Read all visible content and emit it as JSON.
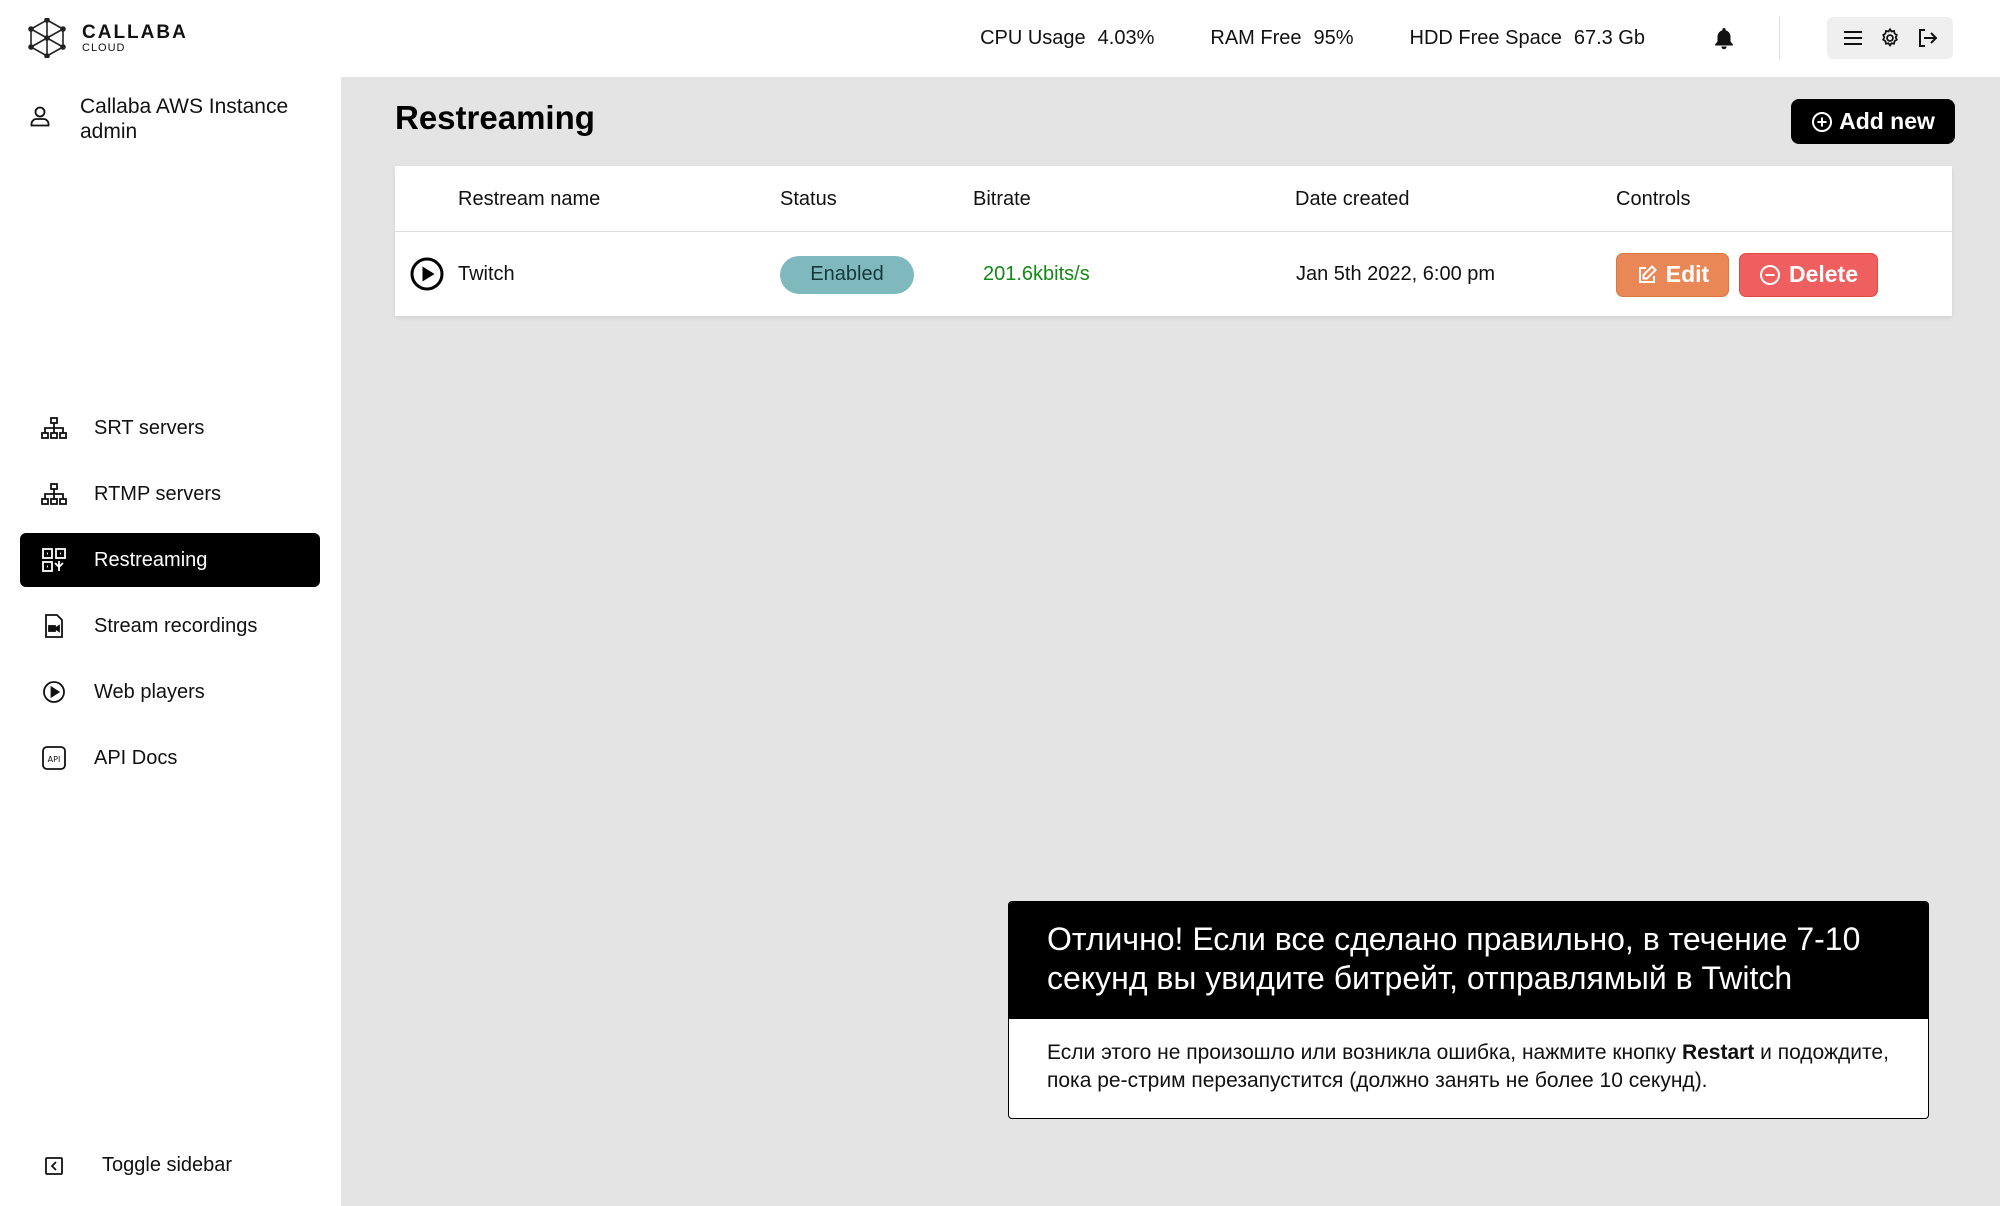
{
  "app": {
    "logo_name": "CALLABA",
    "logo_sub": "CLOUD",
    "instance": "Callaba AWS Instance",
    "user": "admin"
  },
  "nav": {
    "items": [
      {
        "label": "SRT servers",
        "icon": "sitemap-icon"
      },
      {
        "label": "RTMP servers",
        "icon": "sitemap-icon"
      },
      {
        "label": "Restreaming",
        "icon": "restream-icon",
        "active": true
      },
      {
        "label": "Stream recordings",
        "icon": "video-file-icon"
      },
      {
        "label": "Web players",
        "icon": "play-circle-icon"
      },
      {
        "label": "API Docs",
        "icon": "api-icon"
      }
    ],
    "toggle_label": "Toggle sidebar"
  },
  "topbar": {
    "cpu_label": "CPU Usage",
    "cpu_value": "4.03%",
    "ram_label": "RAM Free",
    "ram_value": "95%",
    "hdd_label": "HDD Free Space",
    "hdd_value": "67.3 Gb"
  },
  "main": {
    "title": "Restreaming",
    "add_new_label": "Add new",
    "columns": [
      "Restream name",
      "Status",
      "Bitrate",
      "Date created",
      "Controls"
    ],
    "rows": [
      {
        "name": "Twitch",
        "status": "Enabled",
        "bitrate": "201.6kbits/s",
        "date": "Jan 5th 2022, 6:00 pm",
        "edit_label": "Edit",
        "delete_label": "Delete"
      }
    ]
  },
  "tooltip": {
    "heading": "Отлично! Если все сделано правильно, в течение 7-10 секунд вы увидите битрейт, отправлямый в Twitch",
    "body_before": "Если этого не произошло или возникла ошибка, нажмите кнопку ",
    "body_bold": "Restart",
    "body_after": " и подождите, пока ре-стрим перезапустится (должно занять не более 10 секунд)."
  },
  "colors": {
    "active_nav_bg": "#000000",
    "status_enabled": "#7fb9bd",
    "bitrate_text": "#138a13",
    "edit_button": "#e98856",
    "delete_button": "#f05f5f",
    "content_bg": "#e4e4e4"
  }
}
